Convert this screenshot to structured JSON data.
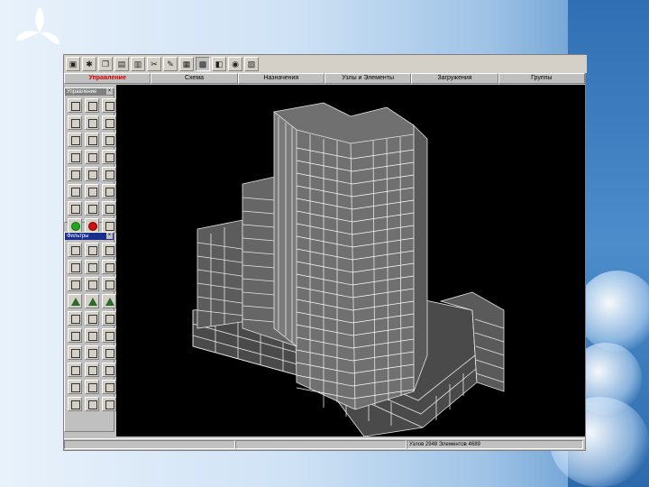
{
  "slide": {
    "accent_color": "#2f6fb3",
    "logo_icon": "tri-leaf-logo-icon"
  },
  "toolbar": {
    "buttons": [
      "save-icon",
      "print-icon",
      "copy-icon",
      "paste-icon",
      "cut-icon",
      "table-icon",
      "grid-icon",
      "view-icon",
      "camera-icon",
      "help-icon"
    ]
  },
  "tabs": [
    {
      "label": "Управление",
      "active": true
    },
    {
      "label": "Схема",
      "active": false
    },
    {
      "label": "Назначения",
      "active": false
    },
    {
      "label": "Узлы и Элементы",
      "active": false
    },
    {
      "label": "Загружения",
      "active": false
    },
    {
      "label": "Группы",
      "active": false
    }
  ],
  "panels": {
    "upper": {
      "title": "Управление",
      "icon_rows": 7
    },
    "lower": {
      "title": "Фильтры",
      "icon_rows": 10
    }
  },
  "statusbar": {
    "stats": "Узлов 2948 Элементов 4689"
  },
  "colors": {
    "viewport_bg": "#000000",
    "mesh": "#ffffff",
    "active_tab": "#d00000"
  }
}
